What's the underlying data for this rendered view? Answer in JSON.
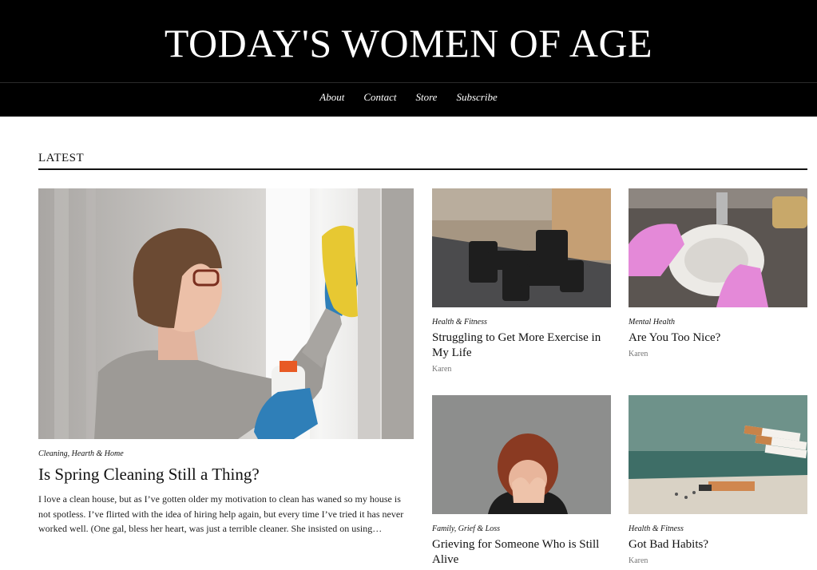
{
  "site": {
    "title": "TODAY'S WOMEN OF AGE"
  },
  "nav": {
    "items": [
      "About",
      "Contact",
      "Store",
      "Subscribe"
    ]
  },
  "section": {
    "title": "LATEST"
  },
  "featured": {
    "category": "Cleaning, Hearth & Home",
    "title": "Is Spring Cleaning Still a Thing?",
    "excerpt": "I love a clean house, but as I’ve gotten older my motivation to clean has waned so my house is not spotless. I’ve flirted with the idea of hiring help again, but every time I’ve tried it has never worked well. (One gal, bless her heart, was just a terrible cleaner. She insisted on using…"
  },
  "posts": [
    {
      "category": "Health & Fitness",
      "title": "Struggling to Get More Exercise in My Life",
      "author": "Karen"
    },
    {
      "category": "Mental Health",
      "title": "Are You Too Nice?",
      "author": "Karen"
    },
    {
      "category": "Family, Grief & Loss",
      "title": "Grieving for Someone Who is Still Alive",
      "author": ""
    },
    {
      "category": "Health & Fitness",
      "title": "Got Bad Habits?",
      "author": "Karen"
    }
  ]
}
